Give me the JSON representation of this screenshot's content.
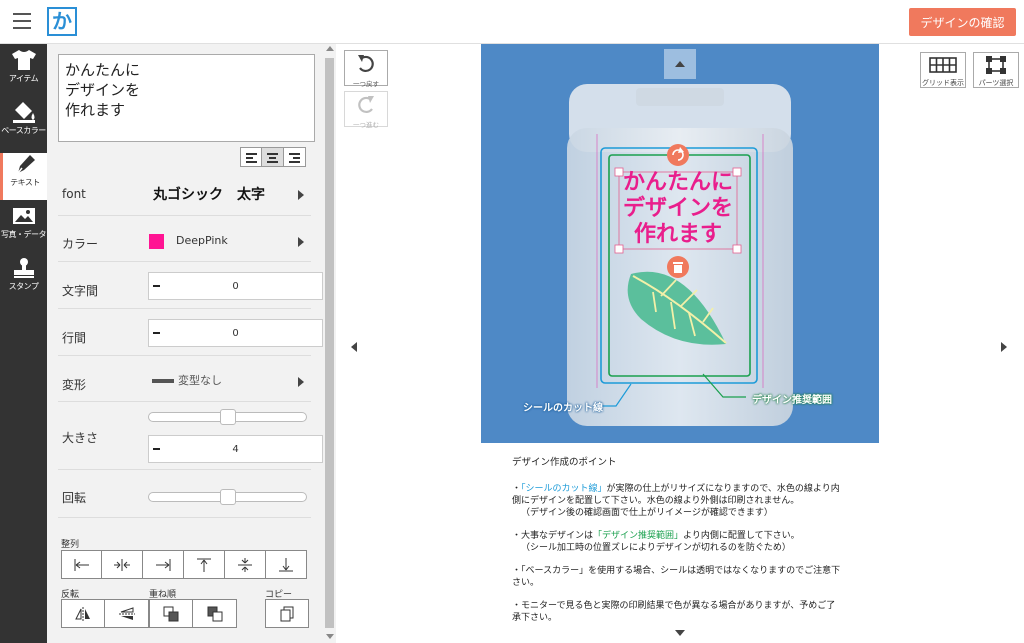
{
  "header": {
    "confirm_label": "デザインの確認",
    "logo_glyph": "か"
  },
  "rail": [
    {
      "label": "アイテム",
      "icon": "tshirt-icon"
    },
    {
      "label": "ベースカラー",
      "icon": "paint-bucket-icon"
    },
    {
      "label": "テキスト",
      "icon": "pen-icon"
    },
    {
      "label": "写真・データ",
      "icon": "image-icon"
    },
    {
      "label": "スタンプ",
      "icon": "stamp-icon"
    }
  ],
  "panel": {
    "text_value": "かんたんに\nデザインを\n作れます",
    "font_label": "font",
    "font_value": "丸ゴシック　太字",
    "color_label": "カラー",
    "color_name": "DeepPink",
    "color_hex": "#ff1493",
    "letter_spacing_label": "文字間",
    "letter_spacing_value": "0",
    "line_spacing_label": "行間",
    "line_spacing_value": "0",
    "transform_label": "変形",
    "transform_value": "変型なし",
    "size_label": "大きさ",
    "size_value": "4",
    "rotation_label": "回転",
    "align_section_label": "整列",
    "flip_label": "反転",
    "order_label": "重ね順",
    "copy_label": "コピー"
  },
  "history": {
    "undo_label": "一つ戻す",
    "redo_label": "一つ進む"
  },
  "canvas_tools": {
    "grid_label": "グリッド表示",
    "parts_label": "パーツ選択"
  },
  "preview": {
    "design_text_lines": [
      "かんたんに",
      "デザインを",
      "作れます"
    ],
    "text_color": "#e91e8c",
    "cut_line_label": "シールのカット線",
    "safe_area_label": "デザイン推奨範囲",
    "cut_line_color": "#1d9bd8",
    "safe_area_color": "#1aa04e",
    "leaf_color": "#5bbf9c"
  },
  "points": {
    "heading": "デザイン作成のポイント",
    "items": [
      {
        "pre": "・",
        "hl": "「シールのカット線」",
        "hl_class": "hl-blue",
        "text": "が実際の仕上がリサイズになりますので、水色の線より内側にデザインを配置して下さい。水色の線より外側は印刷されません。",
        "note": "（デザイン後の確認画面で仕上がリイメージが確認できます）"
      },
      {
        "pre": "・大事なデザインは",
        "hl": "「デザイン推奨範囲」",
        "hl_class": "hl-green",
        "text": "より内側に配置して下さい。",
        "note": "（シール加工時の位置ズレによりデザインが切れるのを防ぐため）"
      },
      {
        "pre": "・",
        "hl": "",
        "hl_class": "",
        "text": "「ベースカラー」を使用する場合、シールは透明ではなくなりますのでご注意下さい。",
        "note": ""
      },
      {
        "pre": "・",
        "hl": "",
        "hl_class": "",
        "text": "モニターで見る色と実際の印刷結果で色が異なる場合がありますが、予めご了承下さい。",
        "note": ""
      }
    ]
  }
}
